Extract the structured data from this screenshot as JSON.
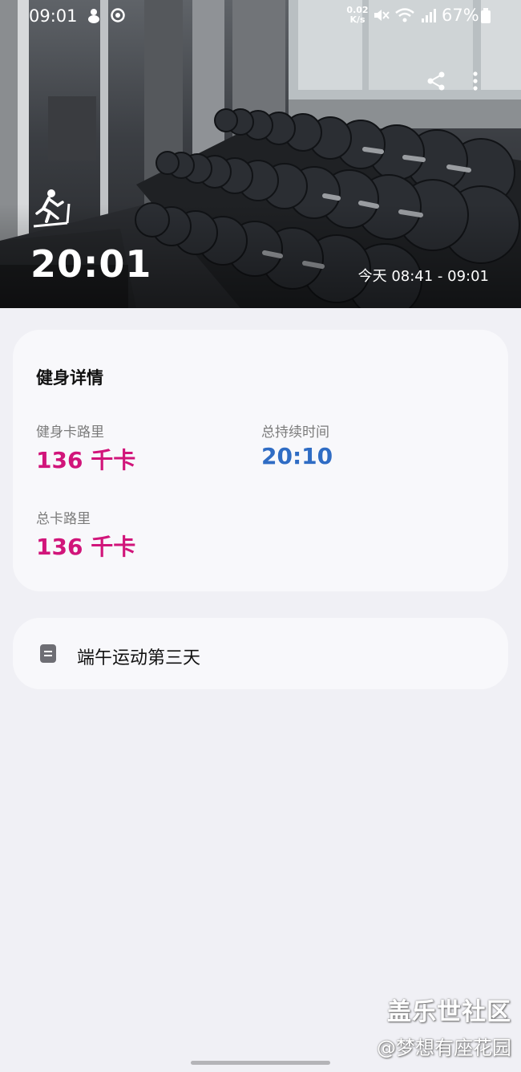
{
  "status_bar": {
    "time": "09:01",
    "net_speed_value": "0.02",
    "net_speed_unit": "K/s",
    "battery": "67%"
  },
  "workout": {
    "duration": "20:01",
    "time_range": "今天 08:41 - 09:01"
  },
  "details": {
    "title": "健身详情",
    "workout_calories_label": "健身卡路里",
    "workout_calories_value": "136 千卡",
    "total_duration_label": "总持续时间",
    "total_duration_value": "20:10",
    "total_calories_label": "总卡路里",
    "total_calories_value": "136 千卡"
  },
  "note": {
    "text": "端午运动第三天"
  },
  "watermark": {
    "main": "盖乐世社区",
    "sub": "@梦想有座花园"
  },
  "colors": {
    "accent_magenta": "#d1157a",
    "accent_blue": "#2f6cc4",
    "background": "#f0f0f5",
    "card": "#f8f8fb"
  },
  "icons": [
    "treadmill-icon",
    "share-icon",
    "more-vert-icon",
    "note-icon",
    "mute-icon",
    "wifi-icon",
    "signal-icon",
    "battery-icon"
  ]
}
